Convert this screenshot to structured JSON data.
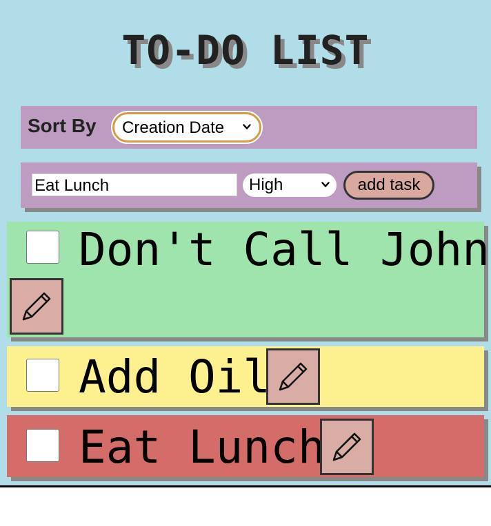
{
  "header": {
    "title": "TO-DO LIST"
  },
  "sort": {
    "label": "Sort By",
    "selected": "Creation Date"
  },
  "add_task": {
    "input_value": "Eat Lunch",
    "priority_selected": "High",
    "button_label": "add task"
  },
  "tasks": [
    {
      "text": "Don't Call John",
      "color": "#9fe3ad",
      "checked": false,
      "edit_icon": "pencil-icon"
    },
    {
      "text": "Add Oil",
      "color": "#fdf08f",
      "checked": false,
      "edit_icon": "pencil-icon"
    },
    {
      "text": "Eat Lunch",
      "color": "#d46c6a",
      "checked": false,
      "edit_icon": "pencil-icon"
    }
  ],
  "colors": {
    "background": "#b0dde7",
    "panel": "#be9bc0",
    "button": "#d9a9a0",
    "select_border": "#d89a40"
  }
}
